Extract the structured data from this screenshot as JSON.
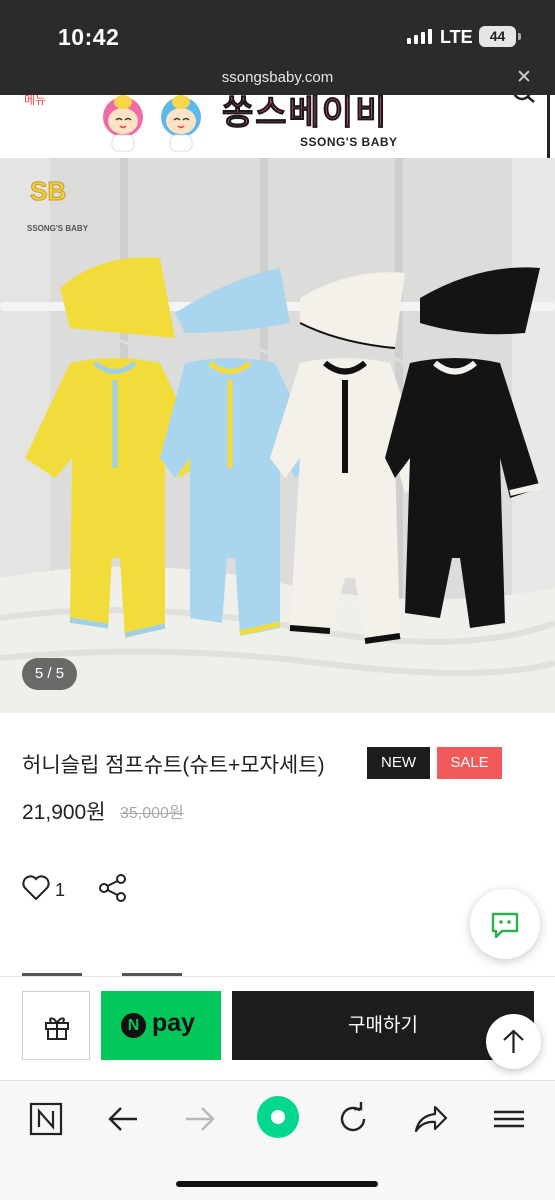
{
  "status_bar": {
    "time": "10:42",
    "network": "LTE",
    "battery": "44"
  },
  "browser": {
    "url": "ssongsbaby.com"
  },
  "store_header": {
    "menu_text": "메뉴",
    "brand_name_kr": "쏭스베이비",
    "brand_name_en": "SSONG'S BABY"
  },
  "product_image": {
    "logo_initials": "SB",
    "logo_text": "SSONG'S BABY",
    "counter": "5 / 5"
  },
  "product": {
    "title": "허니슬립 점프슈트(슈트+모자세트)",
    "badges": {
      "new": "NEW",
      "sale": "SALE"
    },
    "price": "21,900원",
    "original_price": "35,000원",
    "like_count": "1"
  },
  "purchase_bar": {
    "npay_mark": "N",
    "npay_label": "pay",
    "buy_label": "구매하기"
  },
  "colors": {
    "npay_green": "#03c75a",
    "sale_red": "#f05a5a",
    "buy_black": "#1d1d1d",
    "brand_pink": "#f04d96"
  },
  "icons": [
    "heart-icon",
    "share-icon",
    "chat-icon",
    "gift-icon",
    "arrow-up-icon",
    "naver-n-icon",
    "back-arrow-icon",
    "forward-arrow-icon",
    "green-dot-icon",
    "reload-icon",
    "share-arrow-icon",
    "hamburger-icon",
    "close-icon"
  ]
}
